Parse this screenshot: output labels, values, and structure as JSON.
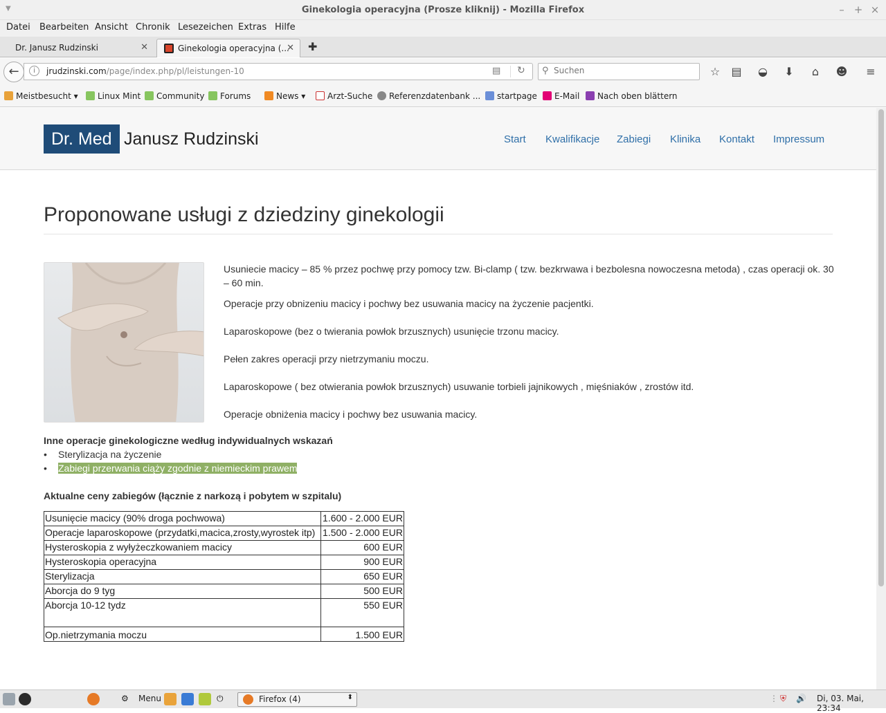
{
  "window": {
    "title": "Ginekologia operacyjna (Prosze kliknij) - Mozilla Firefox"
  },
  "menubar": [
    "Datei",
    "Bearbeiten",
    "Ansicht",
    "Chronik",
    "Lesezeichen",
    "Extras",
    "Hilfe"
  ],
  "tabs": [
    {
      "label": "Dr. Janusz Rudzinski",
      "active": false
    },
    {
      "label": "Ginekologia operacyjna (...",
      "active": true
    }
  ],
  "urlbar": {
    "domain": "jrudzinski.com",
    "path": "/page/index.php/pl/leistungen-10"
  },
  "searchbar": {
    "placeholder": "Suchen"
  },
  "bookmarks": [
    "Meistbesucht",
    "Linux Mint",
    "Community",
    "Forums",
    "News",
    "Arzt-Suche",
    "Referenzdatenbank ...",
    "startpage",
    "E-Mail",
    "Nach oben blättern"
  ],
  "site": {
    "logo_box": "Dr. Med",
    "logo_name": "Janusz Rudzinski",
    "nav": [
      "Start",
      "Kwalifikacje",
      "Zabiegi",
      "Klinika",
      "Kontakt",
      "Impressum"
    ],
    "title": "Proponowane usługi z dziedziny ginekologii",
    "paragraphs": [
      "Usuniecie macicy – 85 % przez pochwę przy pomocy tzw. Bi-clamp ( tzw. bezkrwawa i bezbolesna nowoczesna metoda) , czas operacji ok. 30 – 60 min.",
      "Operacje przy obnizeniu macicy i pochwy bez usuwania macicy na życzenie pacjentki.",
      "Laparoskopowe (bez o twierania powłok brzusznych) usunięcie trzonu macicy.",
      "Pełen zakres operacji przy nietrzymaniu moczu.",
      "Laparoskopowe ( bez otwierania powłok brzusznych) usuwanie torbieli jajnikowych , mięśniaków , zrostów itd.",
      "Operacje obniżenia macicy i pochwy bez usuwania macicy."
    ],
    "other_heading": "Inne operacje ginekologiczne według indywidualnych wskazań",
    "other_items": [
      "Sterylizacja na życzenie",
      "Zabiegi przerwania ciąży zgodnie z niemieckim prawem"
    ],
    "prices_heading": "Aktualne ceny zabiegów (łącznie z narkozą i pobytem w szpitalu)",
    "prices": [
      {
        "name": "Usunięcie macicy (90% droga pochwowa)",
        "price": "1.600 - 2.000 EUR"
      },
      {
        "name": "Operacje laparoskopowe (przydatki,macica,zrosty,wyrostek itp)",
        "price": "1.500 - 2.000 EUR"
      },
      {
        "name": "Hysteroskopia z wyłyżeczkowaniem macicy",
        "price": "600 EUR"
      },
      {
        "name": "Hysteroskopia operacyjna",
        "price": "900 EUR"
      },
      {
        "name": "Sterylizacja",
        "price": "650 EUR"
      },
      {
        "name": "Aborcja do 9 tyg",
        "price": "500 EUR"
      },
      {
        "name": "Aborcja 10-12 tydz",
        "price": "550 EUR"
      },
      {
        "name": "Op.nietrzymania moczu",
        "price": "1.500 EUR"
      }
    ]
  },
  "taskbar": {
    "menu_label": "Menu",
    "window_button": "Firefox (4)",
    "clock": "Di, 03. Mai, 23:34"
  },
  "colors": {
    "logo_bg": "#1f4c78",
    "nav_link": "#2f6fa8",
    "highlight": "#8fb065"
  }
}
